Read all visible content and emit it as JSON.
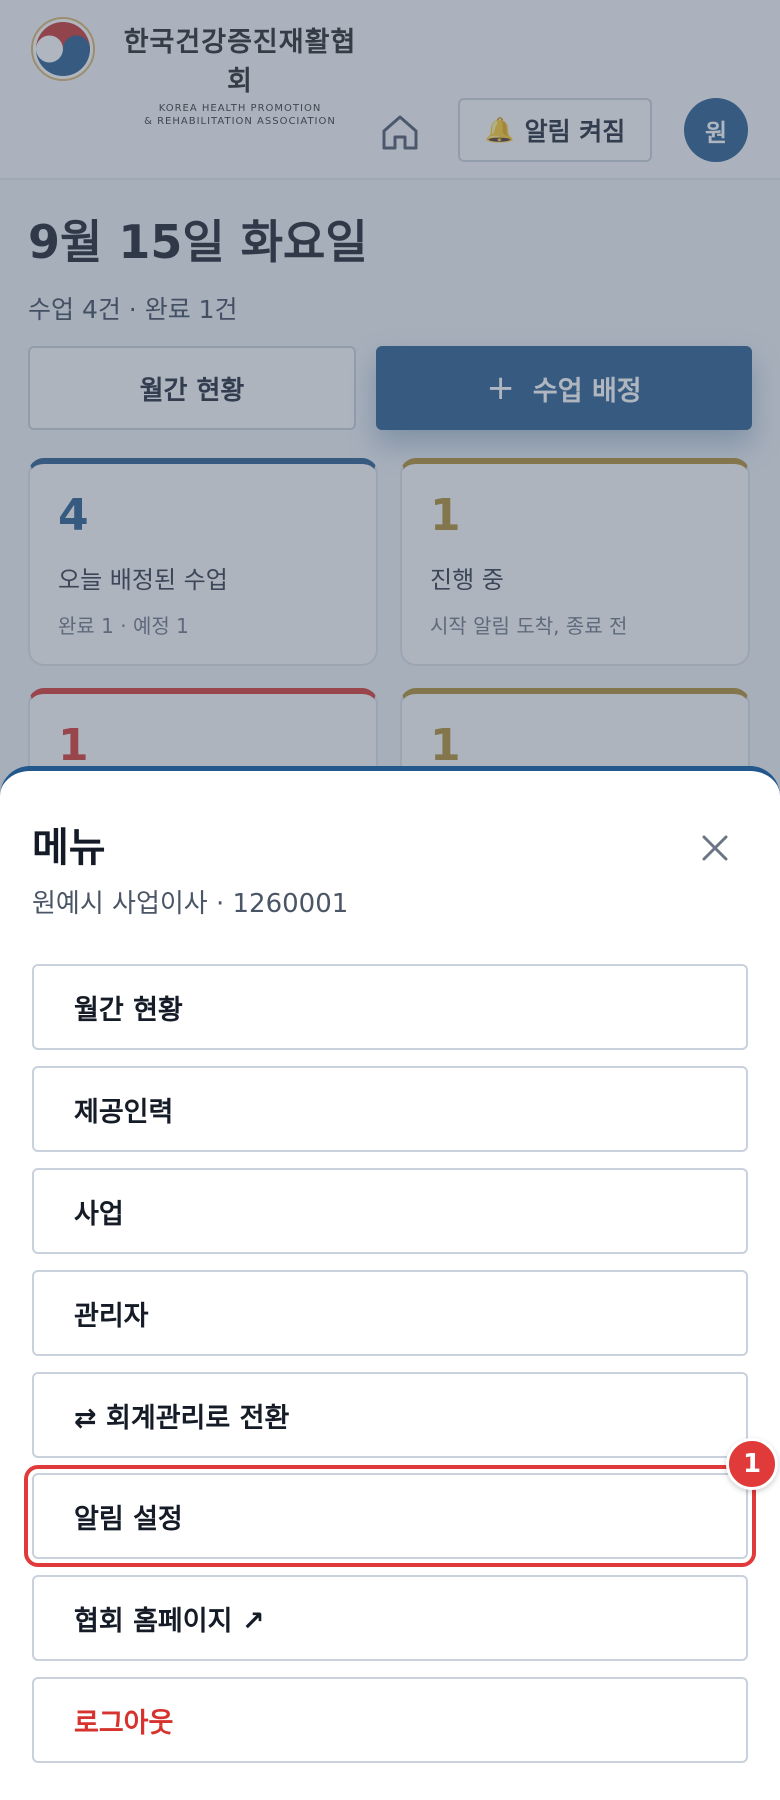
{
  "header": {
    "logo_name_ko": "한국건강증진재활협회",
    "logo_name_en_line1": "KOREA HEALTH PROMOTION",
    "logo_name_en_line2": "& REHABILITATION ASSOCIATION",
    "home_icon": "home-icon",
    "notification_label": "알림 켜짐",
    "bell_icon": "bell-icon",
    "avatar_initial": "원"
  },
  "dashboard": {
    "date_title": "9월 15일 화요일",
    "summary": "수업 4건 · 완료 1건",
    "monthly_button": "월간 현황",
    "assign_plus": "+",
    "assign_button": "수업 배정",
    "cards": [
      {
        "number": "4",
        "label": "오늘 배정된 수업",
        "sub": "완료 1 · 예정 1",
        "color": "#23588c"
      },
      {
        "number": "1",
        "label": "진행 중",
        "sub": "시작 알림 도착, 종료 전",
        "color": "#b08a2e"
      },
      {
        "number": "1",
        "color": "#d6322e"
      },
      {
        "number": "1",
        "color": "#b08a2e"
      }
    ]
  },
  "menu": {
    "title": "메뉴",
    "subtitle": "원예시 사업이사 · 1260001",
    "close_icon": "close-icon",
    "items": [
      {
        "label": "월간 현황"
      },
      {
        "label": "제공인력"
      },
      {
        "label": "사업"
      },
      {
        "label": "관리자"
      },
      {
        "label": "⇄ 회계관리로 전환"
      },
      {
        "label": "알림 설정"
      },
      {
        "label": "협회 홈페이지 ↗"
      },
      {
        "label": "로그아웃"
      }
    ],
    "highlight_badge": "1"
  },
  "colors": {
    "primary": "#23588c",
    "gold": "#b08a2e",
    "danger": "#d6322e",
    "highlight": "#e03a3a"
  }
}
